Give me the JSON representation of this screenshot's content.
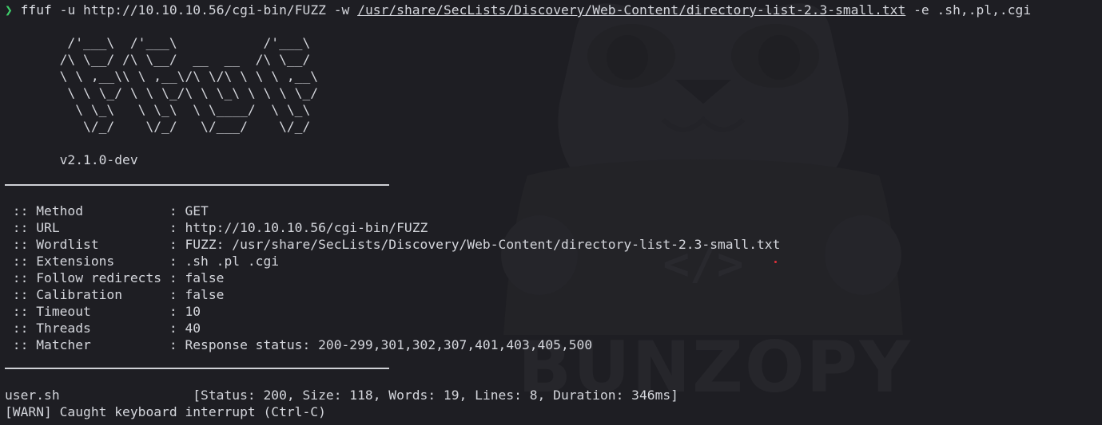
{
  "prompt": {
    "arrow": "❯",
    "command": "ffuf",
    "args_before": " -u http://10.10.10.56/cgi-bin/FUZZ -w ",
    "wordlist_path": "/usr/share/SecLists/Discovery/Web-Content/directory-list-2.3-small.txt",
    "args_after": " -e .sh,.pl,.cgi"
  },
  "banner": {
    "ascii_art": "        /'___\\  /'___\\           /'___\\       \n       /\\ \\__/ /\\ \\__/  __  __  /\\ \\__/       \n       \\ \\ ,__\\\\ \\ ,__\\/\\ \\/\\ \\ \\ \\ ,__\\      \n        \\ \\ \\_/ \\ \\ \\_/\\ \\ \\_\\ \\ \\ \\ \\_/      \n         \\ \\_\\   \\ \\_\\  \\ \\____/  \\ \\_\\       \n          \\/_/    \\/_/   \\/___/    \\/_/       \n\n       v2.1.0-dev"
  },
  "config": [
    {
      "text": " :: Method           : GET"
    },
    {
      "text": " :: URL              : http://10.10.10.56/cgi-bin/FUZZ"
    },
    {
      "text": " :: Wordlist         : FUZZ: /usr/share/SecLists/Discovery/Web-Content/directory-list-2.3-small.txt"
    },
    {
      "text": " :: Extensions       : .sh .pl .cgi"
    },
    {
      "text": " :: Follow redirects : false"
    },
    {
      "text": " :: Calibration      : false"
    },
    {
      "text": " :: Timeout          : 10"
    },
    {
      "text": " :: Threads          : 40"
    },
    {
      "text": " :: Matcher          : Response status: 200-299,301,302,307,401,403,405,500"
    }
  ],
  "results": [
    {
      "text": "user.sh                 [Status: 200, Size: 118, Words: 19, Lines: 8, Duration: 346ms]"
    }
  ],
  "warning": "[WARN] Caught keyboard interrupt (Ctrl-C)",
  "watermark": {
    "text": "BUNZOPY",
    "code_glyph": "</>"
  },
  "colors": {
    "background": "#1e1e23",
    "foreground": "#d4d6dc",
    "prompt_arrow": "#3fd16b",
    "watermark": "#26262b",
    "cursor_dot": "#e0303a"
  }
}
